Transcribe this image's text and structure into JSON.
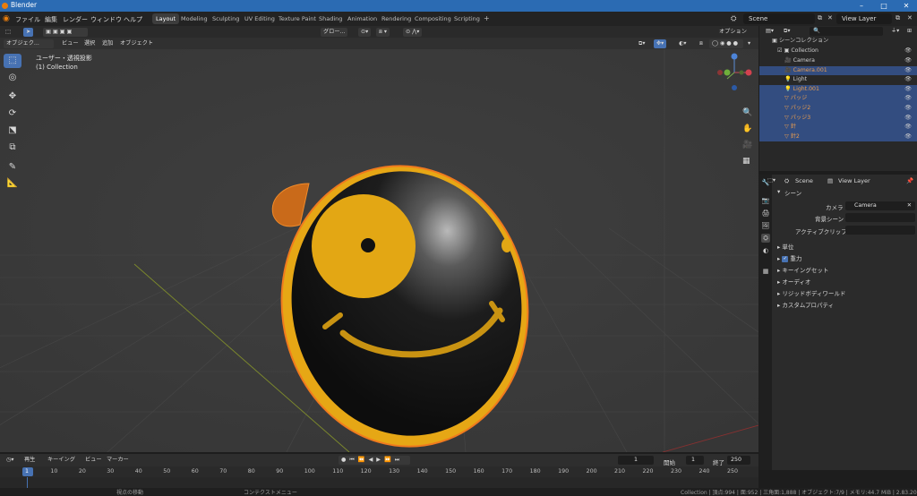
{
  "window": {
    "title": "Blender"
  },
  "menu": [
    "ファイル",
    "編集",
    "レンダー",
    "ウィンドウ",
    "ヘルプ"
  ],
  "workspace_tabs": [
    "Layout",
    "Modeling",
    "Sculpting",
    "UV Editing",
    "Texture Paint",
    "Shading",
    "Animation",
    "Rendering",
    "Compositing",
    "Scripting"
  ],
  "active_tab": "Layout",
  "scene": {
    "name": "Scene",
    "view_layer": "View Layer"
  },
  "viewport_header": {
    "mode": "オブジェク...",
    "menus": [
      "ビュー",
      "選択",
      "追加",
      "オブジェクト"
    ],
    "transform_orientation": "グロー...",
    "options": "オプション"
  },
  "viewport_info": {
    "line1": "ユーザー・透視投影",
    "line2": "(1) Collection"
  },
  "outliner": {
    "root": "シーンコレクション",
    "collection": "Collection",
    "items": [
      {
        "name": "Camera",
        "selected": false,
        "color": "#d0d0d0"
      },
      {
        "name": "Camera.001",
        "selected": true,
        "color": "#e89c4f"
      },
      {
        "name": "Light",
        "selected": false,
        "color": "#d0d0d0"
      },
      {
        "name": "Light.001",
        "selected": true,
        "color": "#e89c4f"
      },
      {
        "name": "パッジ",
        "selected": true,
        "color": "#e89c4f"
      },
      {
        "name": "パッジ2",
        "selected": true,
        "color": "#e89c4f"
      },
      {
        "name": "パッジ3",
        "selected": true,
        "color": "#e89c4f"
      },
      {
        "name": "針",
        "selected": true,
        "color": "#e89c4f"
      },
      {
        "name": "針2",
        "selected": true,
        "color": "#e89c4f"
      }
    ]
  },
  "properties": {
    "scene": "Scene",
    "view_layer": "View Layer",
    "section": "シーン",
    "camera_label": "カメラ",
    "camera_value": "Camera",
    "bg_scene_label": "背景シーン",
    "active_clip_label": "アクティブクリップ",
    "subsections": [
      "単位",
      "重力",
      "キーイングセット",
      "オーディオ",
      "リジッドボディワールド",
      "カスタムプロパティ"
    ]
  },
  "timeline": {
    "menus": [
      "再生",
      "キーイング",
      "ビュー",
      "マーカー"
    ],
    "current_frame": "1",
    "start_label": "開始",
    "start": "1",
    "end_label": "終了",
    "end": "250",
    "ticks": [
      "1",
      "10",
      "20",
      "30",
      "40",
      "50",
      "60",
      "70",
      "80",
      "90",
      "100",
      "110",
      "120",
      "130",
      "140",
      "150",
      "160",
      "170",
      "180",
      "190",
      "200",
      "210",
      "220",
      "230",
      "240",
      "250"
    ]
  },
  "statusbar": {
    "left": "視点の移動",
    "mid": "コンテクストメニュー",
    "right": "Collection | 頂点:994 | 面:952 | 三角面:1,888 | オブジェクト:7/9 | メモリ:44.7 MiB | 2.83.20"
  },
  "colors": {
    "accent": "#4772b3",
    "selection": "#334d80",
    "badge_yellow": "#e3a714",
    "badge_black": "#151515",
    "outline_orange": "#f07a1e"
  },
  "icons": [
    "blender-logo-icon",
    "select-box-icon",
    "cursor-icon",
    "move-icon",
    "rotate-icon",
    "scale-icon",
    "transform-icon",
    "annotate-icon",
    "measure-icon",
    "zoom-icon",
    "hand-icon",
    "camera-view-icon",
    "grid-view-icon",
    "eye-icon",
    "filter-icon",
    "camera-icon",
    "light-icon",
    "mesh-icon"
  ]
}
